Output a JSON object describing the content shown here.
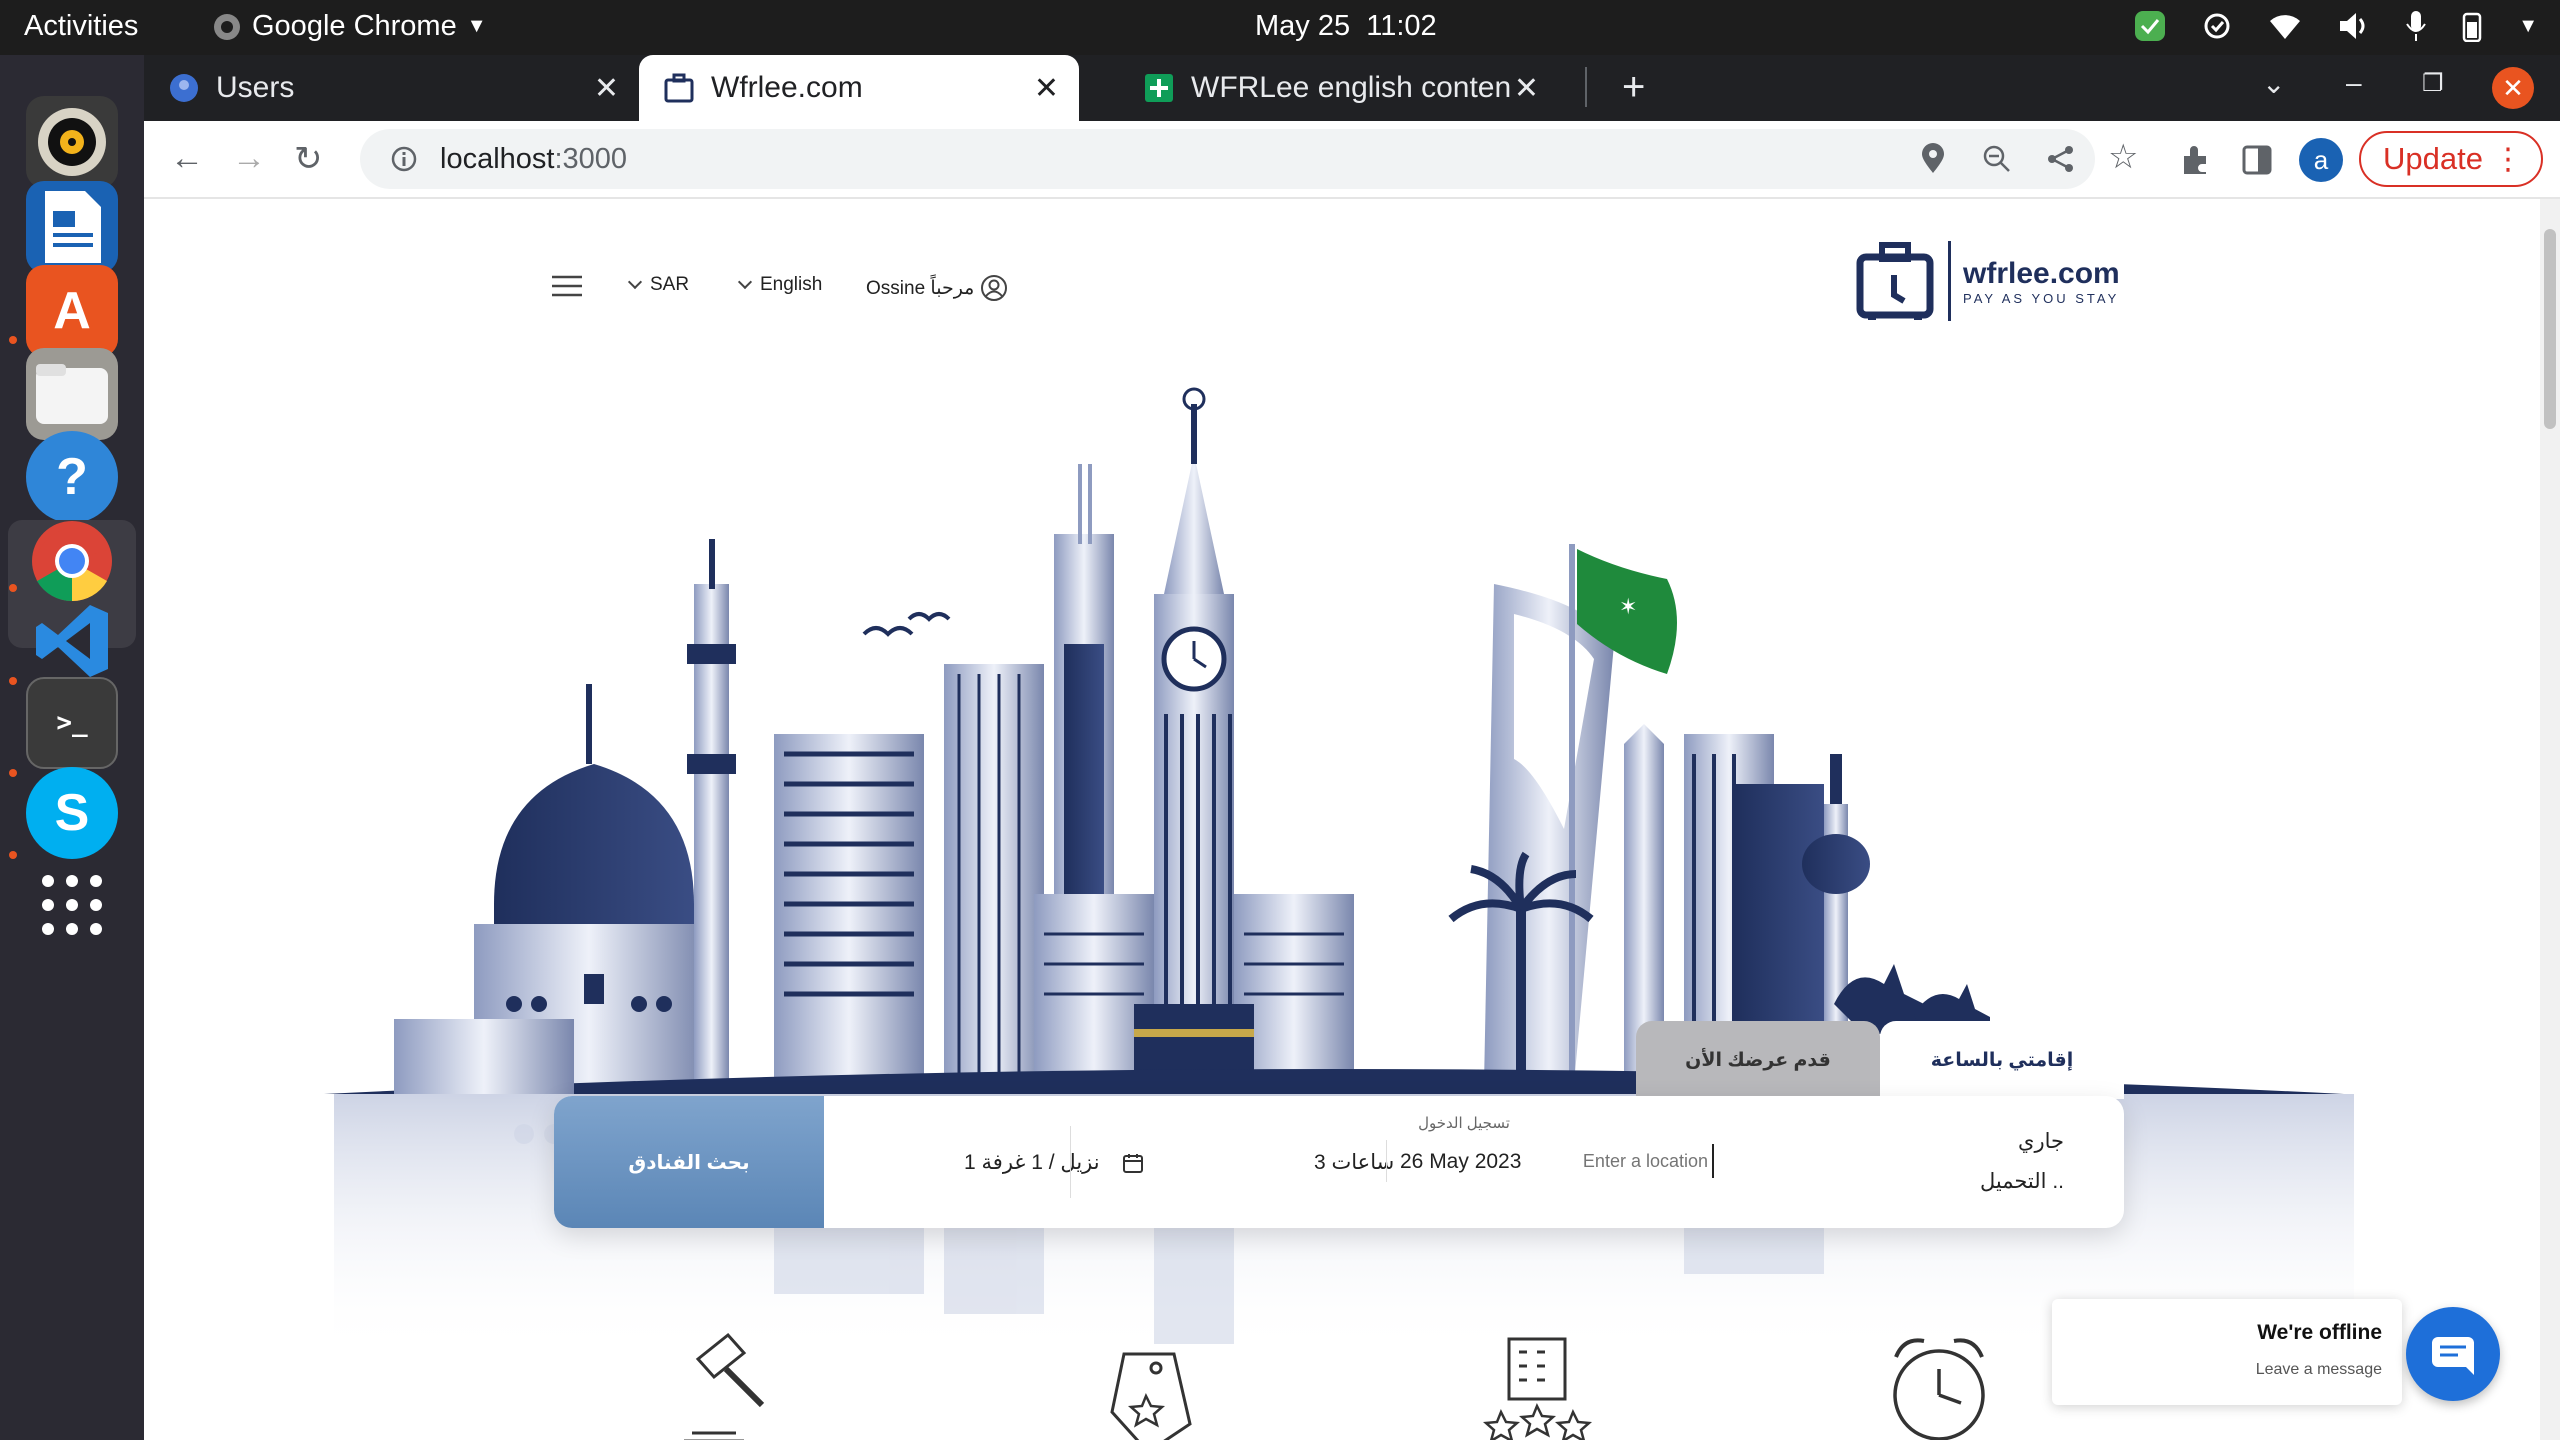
{
  "topbar": {
    "activities": "Activities",
    "app": "Google Chrome",
    "date": "May 25",
    "time": "11:02"
  },
  "tabs": [
    {
      "title": "Users",
      "close": "✕"
    },
    {
      "title": "Wfrlee.com",
      "close": "✕"
    },
    {
      "title": "WFRLee english content (",
      "close": "✕"
    }
  ],
  "address": {
    "host": "localhost",
    "port": ":3000",
    "update_label": "Update",
    "profile_initial": "a"
  },
  "header": {
    "currency": "SAR",
    "language": "English",
    "user_greeting": "Ossine مرحباً",
    "logo_name": "wfrlee.com",
    "logo_tagline": "PAY AS YOU STAY"
  },
  "search_tabs": {
    "hourly": "إقامتي بالساعة",
    "offer": "قدم عرضك الأن"
  },
  "search": {
    "loading_line1": "جاري",
    "loading_line2": "التحميل ..",
    "location_placeholder": "Enter a location",
    "checkin_label": "تسجيل الدخول",
    "checkin_date": "26 May 2023",
    "hours": "3 ساعات",
    "guests": "1 نزيل  /  1 غرفة",
    "search_button": "بحث الفنادق"
  },
  "chat": {
    "title": "We're offline",
    "subtitle": "Leave a message"
  },
  "colors": {
    "navy": "#1f2f5c",
    "search_blue": "#6b93c2",
    "flag_green": "#1f8a3c",
    "update_red": "#d93025"
  }
}
